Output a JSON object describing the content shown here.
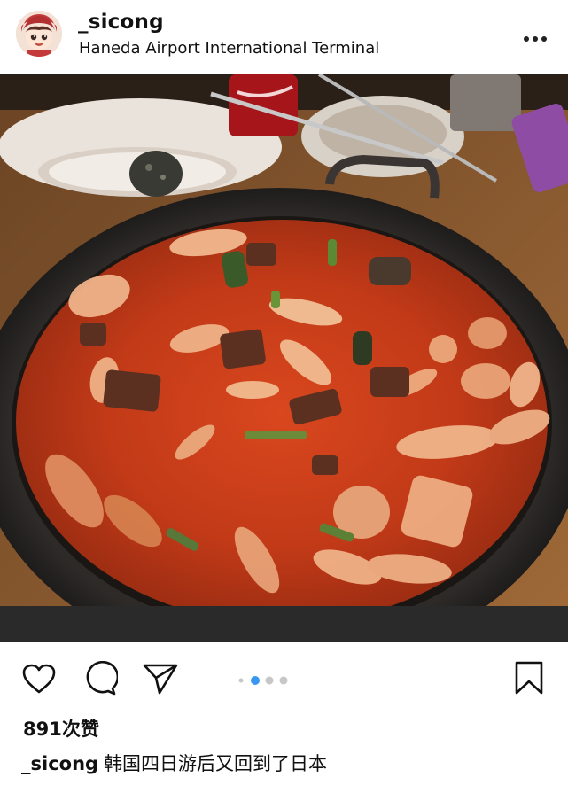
{
  "post": {
    "username": "_sicong",
    "location": "Haneda Airport International Terminal",
    "likes_text": "891次赞",
    "caption_user": "_sicong",
    "caption_text": "韩国四日游后又回到了日本"
  },
  "carousel": {
    "count": 4,
    "active_index": 1
  },
  "icons": {
    "header": [
      "avatar",
      "more-options-icon"
    ],
    "actions": [
      "heart-icon",
      "comment-icon",
      "share-icon",
      "bookmark-icon"
    ]
  },
  "colors": {
    "stew": "#c8381a",
    "pot": "#2a2522",
    "table": "#8a5a2e",
    "active_dot": "#3897f0",
    "inactive_dot": "#c7c7c7"
  }
}
